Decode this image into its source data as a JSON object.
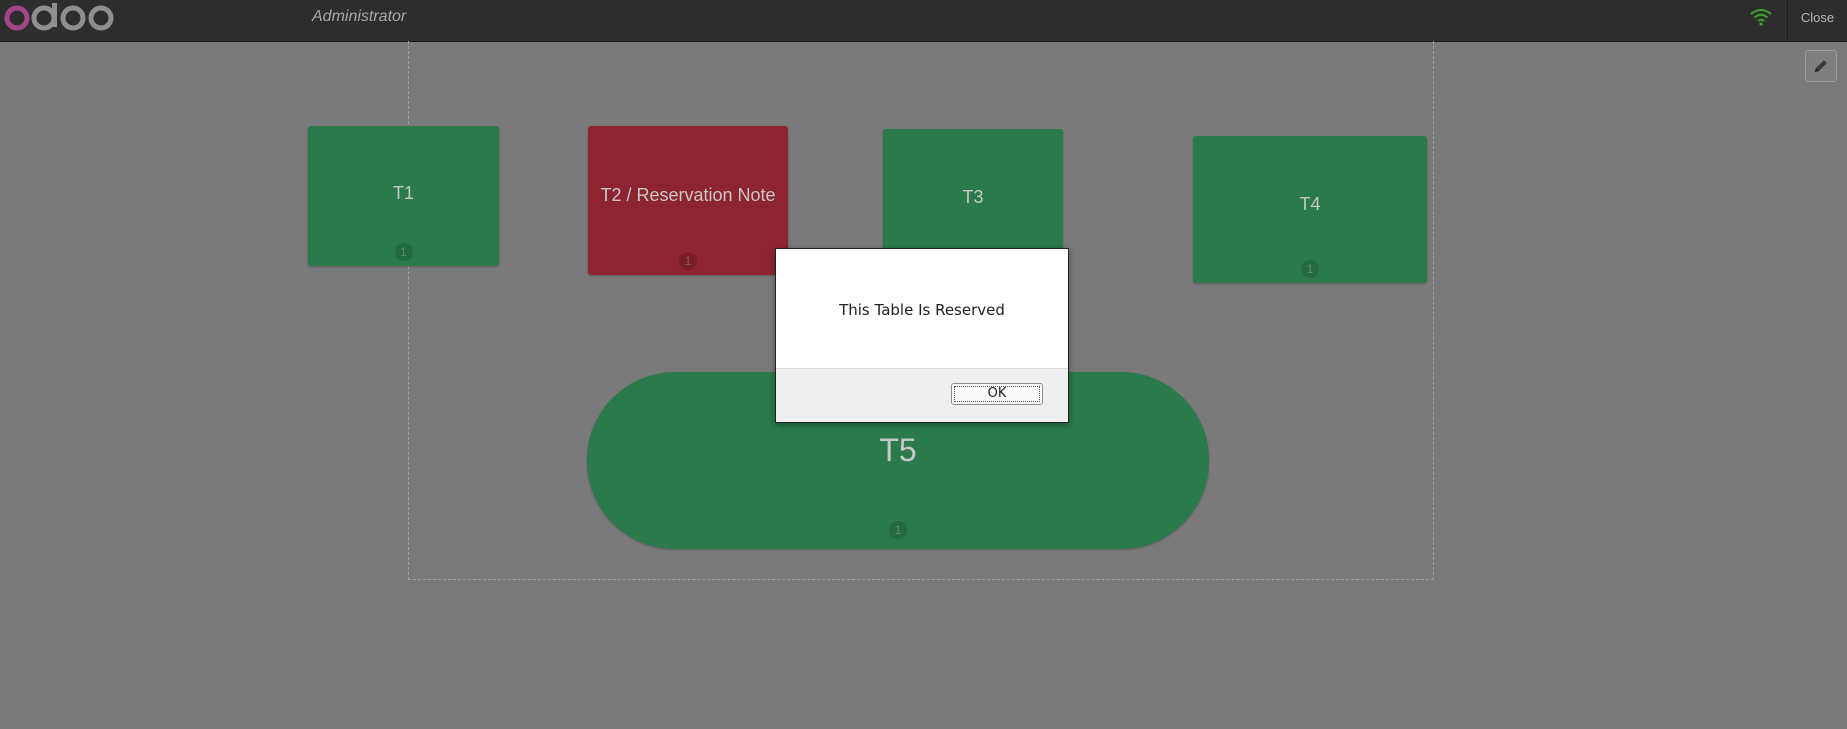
{
  "topbar": {
    "user": "Administrator",
    "close_label": "Close",
    "connection_status_color": "#3e9b2e"
  },
  "floor": {
    "tables": [
      {
        "name": "T1",
        "seats": "1",
        "status": "available",
        "color": "#2a7a4b"
      },
      {
        "name": "T2 / Reservation Note",
        "seats": "1",
        "status": "reserved",
        "color": "#8d2430"
      },
      {
        "name": "T3",
        "seats": "",
        "status": "available",
        "color": "#2a7a4b"
      },
      {
        "name": "T4",
        "seats": "1",
        "status": "available",
        "color": "#2a7a4b"
      },
      {
        "name": "T5",
        "seats": "1",
        "status": "available",
        "color": "#2a7a4b"
      }
    ]
  },
  "modal": {
    "message": "This Table Is Reserved",
    "ok_label": "OK"
  },
  "icons": {
    "logo": "odoo-logo",
    "wifi": "wifi-icon",
    "edit": "pencil-icon"
  }
}
